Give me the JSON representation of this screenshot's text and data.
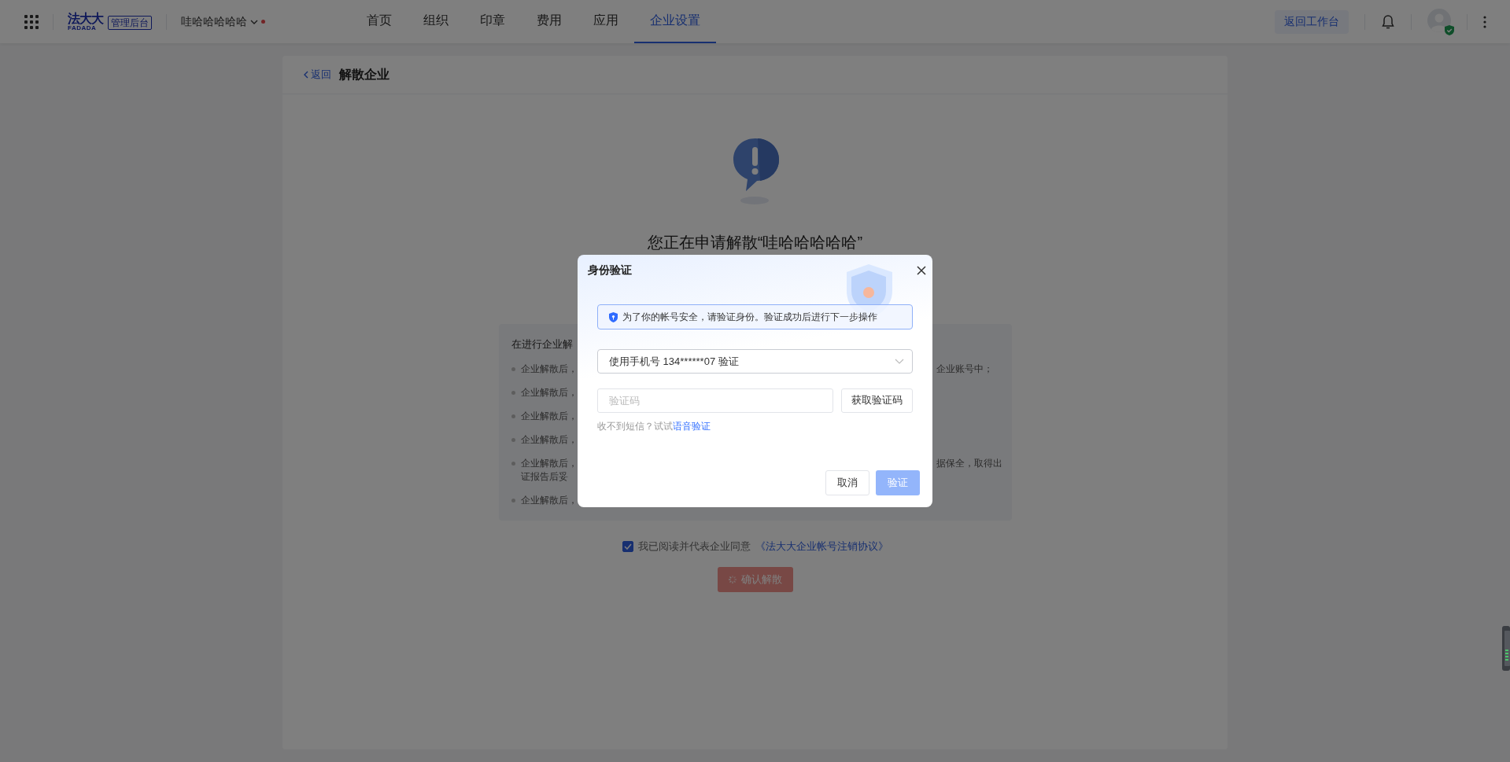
{
  "top_bar": {
    "logo": {
      "name": "法大大",
      "sub": "FADADA",
      "badge": "管理后台"
    },
    "org_switcher": {
      "label": "哇哈哈哈哈哈",
      "has_notice": true
    },
    "nav": [
      {
        "label": "首页",
        "selected": false
      },
      {
        "label": "组织",
        "selected": false
      },
      {
        "label": "印章",
        "selected": false
      },
      {
        "label": "费用",
        "selected": false
      },
      {
        "label": "应用",
        "selected": false
      },
      {
        "label": "企业设置",
        "selected": true
      }
    ],
    "workbench_button": "返回工作台"
  },
  "page": {
    "back_link": "返回",
    "title": "解散企业",
    "heading": "您正在申请解散“哇哈哈哈哈哈”",
    "notice": {
      "title": "在进行企业解",
      "items": [
        {
          "lines": [
            {
              "left": "企业解散后，",
              "right": "企业账号中；"
            }
          ]
        },
        {
          "lines": [
            {
              "left": "企业解散后，"
            }
          ]
        },
        {
          "lines": [
            {
              "left": "企业解散后，"
            }
          ]
        },
        {
          "lines": [
            {
              "left": "企业解散后，"
            }
          ]
        },
        {
          "lines": [
            {
              "left": "企业解散后，",
              "right": "据保全，取得出"
            },
            {
              "left": "证报告后妥"
            }
          ]
        },
        {
          "lines": [
            {
              "left": "企业解散后，"
            }
          ]
        }
      ]
    },
    "agreement": {
      "checked": true,
      "text": "我已阅读并代表企业同意",
      "link": "《法大大企业帐号注销协议》"
    },
    "confirm_button": {
      "label": "确认解散",
      "loading": true
    }
  },
  "dialog": {
    "title": "身份验证",
    "alert": "为了你的帐号安全，请验证身份。验证成功后进行下一步操作",
    "method_select": {
      "value": "使用手机号 134******07 验证"
    },
    "code_field": {
      "placeholder": "验证码"
    },
    "get_code_button": "获取验证码",
    "hint": "收不到短信？试试",
    "hint_link": "语音验证",
    "buttons": [
      {
        "label": "取消",
        "kind": "default",
        "disabled": false
      },
      {
        "label": "验证",
        "kind": "primary",
        "disabled": true
      }
    ]
  }
}
